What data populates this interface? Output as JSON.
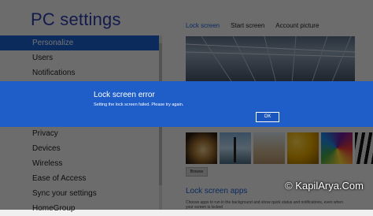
{
  "left": {
    "title": "PC settings",
    "nav_upper": [
      "Personalize",
      "Users",
      "Notifications"
    ],
    "nav_lower": [
      "Privacy",
      "Devices",
      "Wireless",
      "Ease of Access",
      "Sync your settings",
      "HomeGroup"
    ]
  },
  "right": {
    "tabs": [
      "Lock screen",
      "Start screen",
      "Account picture"
    ],
    "browse_label": "Browse",
    "apps_heading": "Lock screen apps",
    "apps_description": "Choose apps to run in the background and show quick status and notifications, even when your screen is locked"
  },
  "dialog": {
    "title": "Lock screen error",
    "message": "Setting the lock screen failed. Please try again.",
    "ok_label": "OK"
  },
  "watermark": "© KapilArya.Com",
  "colors": {
    "accent": "#1a5fcf",
    "dialog_bg": "#1f5ec9",
    "title": "#2b3aa8"
  }
}
